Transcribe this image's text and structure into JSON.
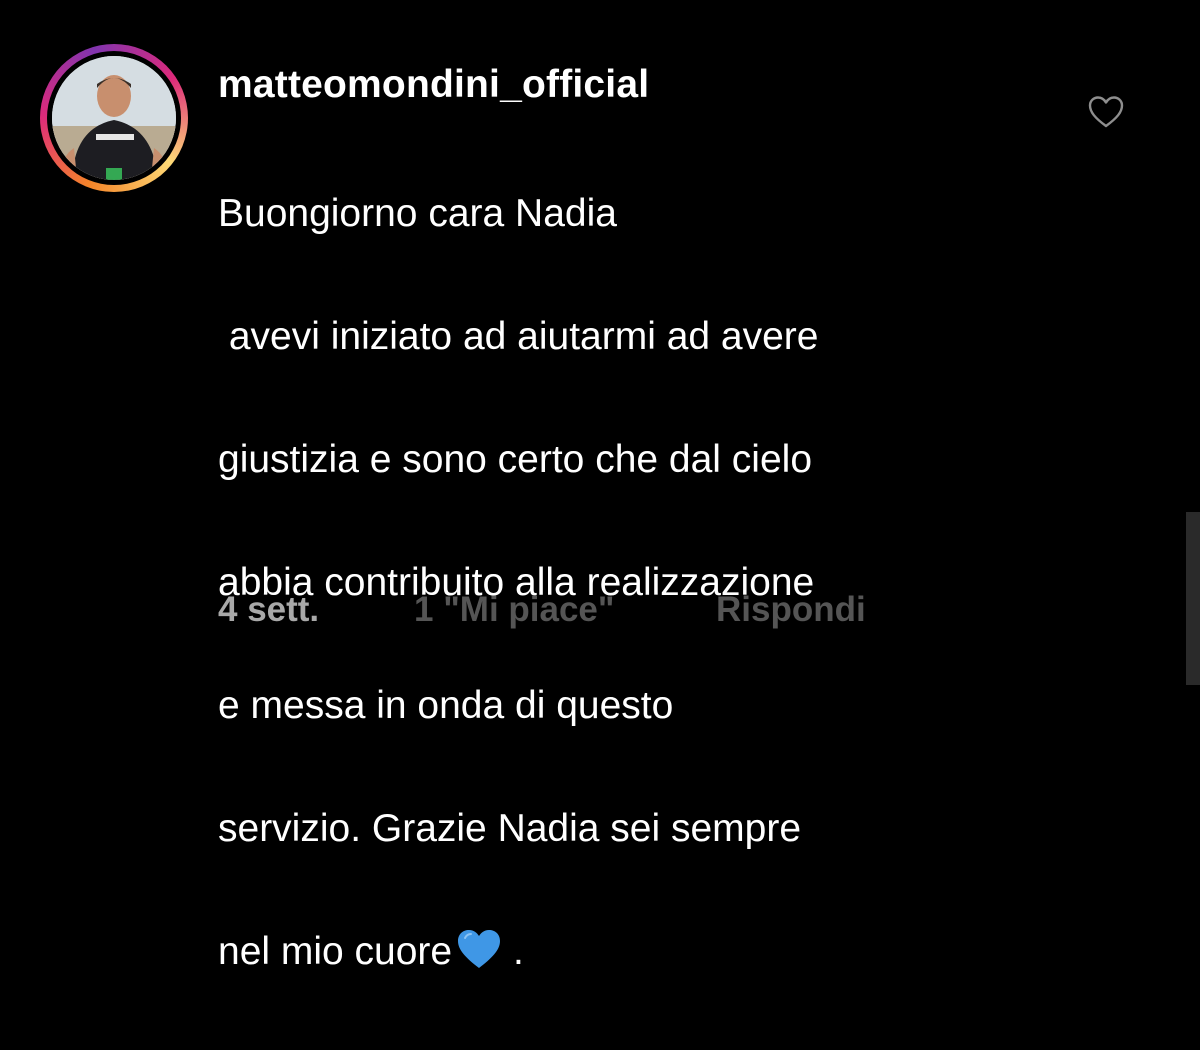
{
  "comment": {
    "username": "matteomondini_official",
    "lines": [
      "Buongiorno cara Nadia",
      " avevi iniziato ad aiutarmi ad avere",
      "giustizia e sono certo che dal cielo",
      "abbia contribuito alla realizzazione",
      "e messa in onda di questo",
      "servizio. Grazie Nadia sei sempre",
      "nel mio cuore"
    ],
    "trailing_emoji": "blue-heart-emoji",
    "trailing_punct": " .",
    "time": "4 sett.",
    "likes": "1 \"Mi piace\"",
    "reply_label": "Rispondi",
    "like_icon": "heart-outline-icon"
  },
  "colors": {
    "background": "#000000",
    "text": "#ffffff",
    "meta_time": "#a8a8a8",
    "meta_muted": "#555555",
    "emoji_heart": "#3f97e6"
  }
}
